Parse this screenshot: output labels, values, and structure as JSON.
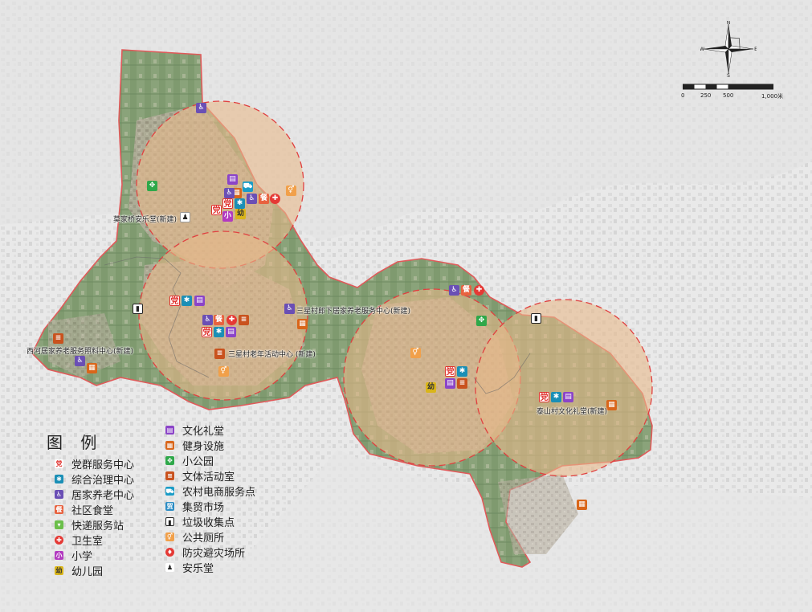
{
  "colors": {
    "party": "#e0312d",
    "circle_fill": "#e8b98a",
    "circle_stroke": "#e04040",
    "boundary": "#e05a5a",
    "background": "#f0f0f0"
  },
  "compass": {
    "n": "N",
    "s": "S",
    "e": "E",
    "w": "W"
  },
  "scale": {
    "labels": [
      "0",
      "250",
      "500",
      "1,000米"
    ]
  },
  "legend": {
    "title": "图 例",
    "items": [
      {
        "key": "dang",
        "glyph": "党",
        "label": "党群服务中心"
      },
      {
        "key": "zhili",
        "glyph": "✱",
        "label": "综合治理中心"
      },
      {
        "key": "yanglao",
        "glyph": "♿",
        "label": "居家养老中心"
      },
      {
        "key": "shitang",
        "glyph": "餐",
        "label": "社区食堂"
      },
      {
        "key": "kuaidi",
        "glyph": "▾",
        "label": "快递服务站"
      },
      {
        "key": "weisheng",
        "glyph": "✚",
        "label": "卫生室"
      },
      {
        "key": "xiaoxue",
        "glyph": "小",
        "label": "小学"
      },
      {
        "key": "youer",
        "glyph": "幼",
        "label": "幼儿园"
      },
      {
        "key": "wenhua",
        "glyph": "▤",
        "label": "文化礼堂"
      },
      {
        "key": "jianshen",
        "glyph": "▦",
        "label": "健身设施"
      },
      {
        "key": "gongyuan",
        "glyph": "✥",
        "label": "小公园"
      },
      {
        "key": "wenti",
        "glyph": "≡",
        "label": "文体活动室"
      },
      {
        "key": "dianshang",
        "glyph": "⛟",
        "label": "农村电商服务点"
      },
      {
        "key": "jimao",
        "glyph": "贸",
        "label": "集贸市场"
      },
      {
        "key": "laji",
        "glyph": "▮",
        "label": "垃圾收集点"
      },
      {
        "key": "cesuo",
        "glyph": "⚥",
        "label": "公共厕所"
      },
      {
        "key": "fangzai",
        "glyph": "♦",
        "label": "防灾避灾场所"
      },
      {
        "key": "anle",
        "glyph": "♟",
        "label": "安乐堂"
      }
    ]
  },
  "map_labels": {
    "mojiaqiao": "莫家桥安乐堂(新建)",
    "sanxing_yanglao": "三星村郎下居家养老服务中心(新建)",
    "xihe": "西河居家养老服务照料中心(新建)",
    "sanxing_laonian": "三星村老年活动中心 (新建)",
    "taishan": "泰山村文化礼堂(新建)"
  },
  "pois": [
    {
      "cat": "yanglao",
      "glyph": "♿"
    },
    {
      "cat": "wenhua",
      "glyph": "▤"
    },
    {
      "cat": "dianshang",
      "glyph": "⛟"
    },
    {
      "cat": "gongyuan",
      "glyph": "✥"
    },
    {
      "cat": "jianshen",
      "glyph": "▦"
    },
    {
      "cat": "yanglao",
      "glyph": "♿"
    },
    {
      "cat": "shitang",
      "glyph": "餐"
    },
    {
      "cat": "weisheng",
      "glyph": "✚"
    },
    {
      "cat": "cesuo",
      "glyph": "⚥"
    },
    {
      "cat": "dang",
      "glyph": "党"
    },
    {
      "cat": "zhili",
      "glyph": "✱"
    },
    {
      "cat": "yanglao",
      "glyph": "♿"
    },
    {
      "cat": "dang",
      "glyph": "党"
    },
    {
      "cat": "xiaoxue",
      "glyph": "小"
    },
    {
      "cat": "youer",
      "glyph": "幼"
    },
    {
      "cat": "anle",
      "glyph": "♟"
    },
    {
      "cat": "yanglao",
      "glyph": "♿"
    },
    {
      "cat": "laji",
      "glyph": "▮"
    },
    {
      "cat": "dang",
      "glyph": "党"
    },
    {
      "cat": "zhili",
      "glyph": "✱"
    },
    {
      "cat": "wenhua",
      "glyph": "▤"
    },
    {
      "cat": "yanglao",
      "glyph": "♿"
    },
    {
      "cat": "shitang",
      "glyph": "餐"
    },
    {
      "cat": "weisheng",
      "glyph": "✚"
    },
    {
      "cat": "wenti",
      "glyph": "≡"
    },
    {
      "cat": "dang",
      "glyph": "党"
    },
    {
      "cat": "zhili",
      "glyph": "✱"
    },
    {
      "cat": "wenhua",
      "glyph": "▤"
    },
    {
      "cat": "wenti",
      "glyph": "≡"
    },
    {
      "cat": "cesuo",
      "glyph": "⚥"
    },
    {
      "cat": "yanglao",
      "glyph": "♿"
    },
    {
      "cat": "jianshen",
      "glyph": "▦"
    },
    {
      "cat": "wenti",
      "glyph": "≡"
    },
    {
      "cat": "yanglao",
      "glyph": "♿"
    },
    {
      "cat": "jianshen",
      "glyph": "▦"
    },
    {
      "cat": "yanglao",
      "glyph": "♿"
    },
    {
      "cat": "shitang",
      "glyph": "餐"
    },
    {
      "cat": "weisheng",
      "glyph": "✚"
    },
    {
      "cat": "gongyuan",
      "glyph": "✥"
    },
    {
      "cat": "cesuo",
      "glyph": "⚥"
    },
    {
      "cat": "dang",
      "glyph": "党"
    },
    {
      "cat": "zhili",
      "glyph": "✱"
    },
    {
      "cat": "wenhua",
      "glyph": "▤"
    },
    {
      "cat": "wenti",
      "glyph": "≡"
    },
    {
      "cat": "youer",
      "glyph": "幼"
    },
    {
      "cat": "laji",
      "glyph": "▮"
    },
    {
      "cat": "dang",
      "glyph": "党"
    },
    {
      "cat": "zhili",
      "glyph": "✱"
    },
    {
      "cat": "wenhua",
      "glyph": "▤"
    },
    {
      "cat": "jianshen",
      "glyph": "▦"
    },
    {
      "cat": "jianshen",
      "glyph": "▦"
    }
  ]
}
